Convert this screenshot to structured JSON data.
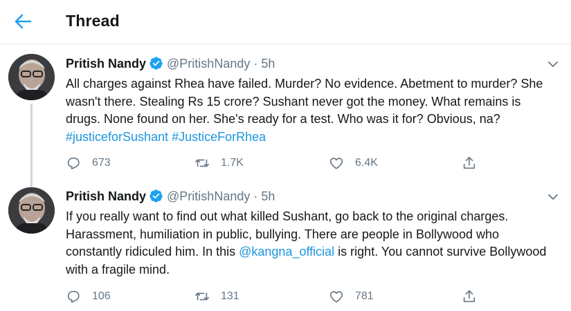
{
  "header": {
    "title": "Thread",
    "back_icon": "arrow-left-icon"
  },
  "colors": {
    "accent": "#1b95e0",
    "text": "#14171a",
    "secondary": "#657786",
    "divider": "#e6ecf0"
  },
  "tweets": [
    {
      "name": "Pritish Nandy",
      "handle": "@PritishNandy",
      "dot": "·",
      "time": "5h",
      "text_before": "All charges against Rhea have failed. Murder? No evidence. Abetment to murder? She wasn't there. Stealing Rs 15 crore? Sushant never got the money. What remains is drugs. None found on her. She's ready for a test. Who was it for? Obvious, na?",
      "link1": "#justiceforSushant",
      "space": " ",
      "link2": "#JusticeForRhea",
      "replies": "673",
      "retweets": "1.7K",
      "likes": "6.4K"
    },
    {
      "name": "Pritish Nandy",
      "handle": "@PritishNandy",
      "dot": "·",
      "time": "5h",
      "text_before": "If you really want to find out what killed Sushant, go back to the original charges. Harassment, humiliation in public, bullying. There are people in Bollywood who constantly ridiculed him. In this ",
      "mention": "@kangna_official",
      "text_after": " is right. You cannot survive Bollywood with a fragile mind.",
      "replies": "106",
      "retweets": "131",
      "likes": "781"
    }
  ]
}
